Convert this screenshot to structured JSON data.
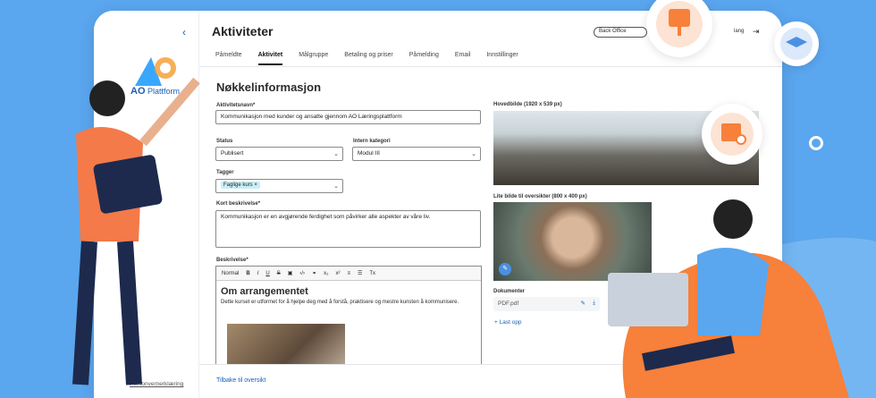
{
  "sidebar": {
    "logo_main": "AO",
    "logo_sub": "Plattform",
    "privacy": "Personvernerklæring",
    "collapse_icon": "chevron-left-icon"
  },
  "header": {
    "title": "Aktiviteter",
    "office_select": "Back Office",
    "lang_text": "lang"
  },
  "tabs": [
    {
      "label": "Påmeldte"
    },
    {
      "label": "Aktivitet"
    },
    {
      "label": "Målgruppe"
    },
    {
      "label": "Betaling og priser"
    },
    {
      "label": "Påmelding"
    },
    {
      "label": "Email"
    },
    {
      "label": "Innstillinger"
    }
  ],
  "section_title": "Nøkkelinformasjon",
  "form": {
    "name_label": "Aktivitetsnavn*",
    "name_value": "Kommunikasjon med kunder og ansatte gjennom AO Læringsplattform",
    "status_label": "Status",
    "status_value": "Publisert",
    "category_label": "Intern kategori",
    "category_value": "Modul III",
    "tags_label": "Tagger",
    "tag_chip": "Faglige kurs",
    "short_label": "Kort beskrivelse*",
    "short_value": "Kommunikasjon er en avgjørende ferdighet som påvirker alle aspekter av våre liv.",
    "desc_label": "Beskrivelse*"
  },
  "editor": {
    "format": "Normal",
    "heading": "Om arrangementet",
    "paragraph": "Dette kurset er utformet for å hjelpe deg med å forstå, praktisere og mestre kunsten å kommunisere."
  },
  "media": {
    "main_label": "Hovedbilde (1920 x 539 px)",
    "small_label": "Lite bilde til oversikter (800 x 400 px)",
    "docs_label": "Dokumenter",
    "doc_name": "PDF.pdf",
    "upload": "Last opp"
  },
  "footer": {
    "back": "Tilbake til oversikt"
  },
  "colors": {
    "accent": "#1a5fb4",
    "background": "#5aa6ef",
    "orange": "#f7803a"
  }
}
